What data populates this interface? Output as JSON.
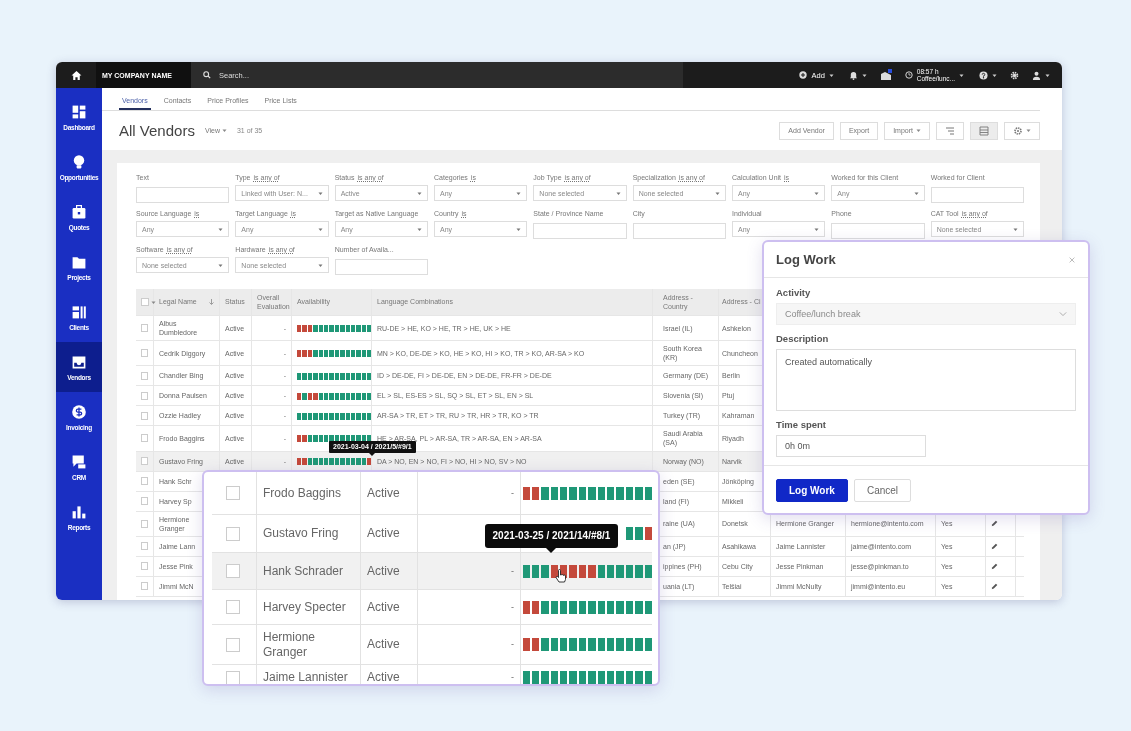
{
  "top_bar": {
    "company": "MY COMPANY NAME",
    "search": {
      "placeholder": "Search..."
    },
    "add": "Add",
    "timer": {
      "time": "08:57 h",
      "activity": "Coffee/lunc..."
    }
  },
  "sidebar": {
    "items": [
      {
        "label": "Dashboard",
        "kind": "dashboard",
        "selected": false
      },
      {
        "label": "Opportunities",
        "kind": "opportunities",
        "selected": false
      },
      {
        "label": "Quotes",
        "kind": "quotes",
        "selected": false
      },
      {
        "label": "Projects",
        "kind": "projects",
        "selected": false
      },
      {
        "label": "Clients",
        "kind": "clients",
        "selected": false
      },
      {
        "label": "Vendors",
        "kind": "vendors",
        "selected": true
      },
      {
        "label": "Invoicing",
        "kind": "invoicing",
        "selected": false
      },
      {
        "label": "CRM",
        "kind": "crm",
        "selected": false
      },
      {
        "label": "Reports",
        "kind": "reports",
        "selected": false
      }
    ]
  },
  "tabs": [
    {
      "label": "Vendors",
      "selected": true
    },
    {
      "label": "Contacts",
      "selected": false
    },
    {
      "label": "Price Profiles",
      "selected": false
    },
    {
      "label": "Price Lists",
      "selected": false
    }
  ],
  "page": {
    "title": "All Vendors",
    "view": "View",
    "count": "31 of 35"
  },
  "toolbar": [
    {
      "kind": "text",
      "label": "Add Vendor",
      "selected": false
    },
    {
      "kind": "text",
      "label": "Export",
      "selected": false
    },
    {
      "kind": "menu",
      "label": "Import",
      "selected": false
    },
    {
      "kind": "filter",
      "selected": false
    },
    {
      "kind": "grid",
      "selected": true
    },
    {
      "kind": "settings",
      "selected": false
    }
  ],
  "filters": [
    [
      {
        "label": "Text",
        "kind": "text"
      },
      {
        "label": "Type",
        "operator": "is any of",
        "kind": "select",
        "value": "Linked with User: N..."
      },
      {
        "label": "Status",
        "operator": "is any of",
        "kind": "select",
        "value": "Active"
      },
      {
        "label": "Categories",
        "operator": "is",
        "kind": "select",
        "value": "Any"
      },
      {
        "label": "Job Type",
        "operator": "is any of",
        "kind": "select",
        "value": "None selected"
      },
      {
        "label": "Specialization",
        "operator": "is any of",
        "kind": "select",
        "value": "None selected"
      },
      {
        "label": "Calculation Unit",
        "operator": "is",
        "kind": "select",
        "value": "Any"
      },
      {
        "label": "Worked for this Client",
        "kind": "select",
        "value": "Any"
      },
      {
        "label": "Worked for Client",
        "kind": "text"
      }
    ],
    [
      {
        "label": "Source Language",
        "operator": "is",
        "kind": "select",
        "value": "Any"
      },
      {
        "label": "Target Language",
        "operator": "is",
        "kind": "select",
        "value": "Any"
      },
      {
        "label": "Target as Native Language",
        "kind": "select",
        "value": "Any"
      },
      {
        "label": "Country",
        "operator": "is",
        "kind": "select",
        "value": "Any"
      },
      {
        "label": "State / Province Name",
        "kind": "text"
      },
      {
        "label": "City",
        "kind": "text"
      },
      {
        "label": "Individual",
        "kind": "select",
        "value": "Any"
      },
      {
        "label": "Phone",
        "kind": "text"
      },
      {
        "label": "CAT Tool",
        "operator": "is any of",
        "kind": "select",
        "value": "None selected"
      }
    ],
    [
      {
        "label": "Software",
        "operator": "is any of",
        "kind": "select",
        "value": "None selected"
      },
      {
        "label": "Hardware",
        "operator": "is any of",
        "kind": "select",
        "value": "None selected"
      },
      {
        "label": "Number of Availa...",
        "kind": "text"
      }
    ]
  ],
  "table": {
    "select_all": {
      "checked": false
    },
    "columns": [
      "Legal Name",
      "Status",
      "Overall Evaluation",
      "Availability",
      "Language Combinations",
      "Address - Country",
      "Address - Ci"
    ],
    "rows": [
      {
        "checked": false,
        "selected": false,
        "name": "Albus Dumbledore",
        "status": "Active",
        "evaluation": "-",
        "busy": [
          true,
          true,
          true,
          false,
          false,
          false,
          false,
          false,
          false,
          false,
          false,
          false,
          false,
          false
        ],
        "languages": "RU-DE > HE, KO > HE, TR > HE, UK > HE",
        "country": "Israel (IL)",
        "city": "Ashkelon"
      },
      {
        "checked": false,
        "selected": false,
        "name": "Cedrik Diggory",
        "status": "Active",
        "evaluation": "-",
        "busy": [
          true,
          true,
          true,
          false,
          false,
          false,
          false,
          false,
          false,
          false,
          false,
          false,
          false,
          false
        ],
        "languages": "MN > KO, DE-DE > KO, HE > KO, HI > KO, TR > KO, AR-SA > KO",
        "country": "South Korea (KR)",
        "city": "Chuncheon"
      },
      {
        "checked": false,
        "selected": false,
        "name": "Chandler Bing",
        "status": "Active",
        "evaluation": "-",
        "busy": [
          false,
          false,
          false,
          false,
          false,
          false,
          false,
          false,
          false,
          false,
          false,
          false,
          false,
          false
        ],
        "languages": "ID > DE-DE, FI > DE-DE, EN > DE-DE, FR-FR > DE-DE",
        "country": "Germany (DE)",
        "city": "Berlin"
      },
      {
        "checked": false,
        "selected": false,
        "name": "Donna Paulsen",
        "status": "Active",
        "evaluation": "-",
        "busy": [
          true,
          false,
          true,
          true,
          false,
          false,
          false,
          false,
          false,
          false,
          false,
          false,
          false,
          false
        ],
        "languages": "EL > SL, ES-ES > SL, SQ > SL, ET > SL, EN > SL",
        "country": "Slovenia (SI)",
        "city": "Ptuj"
      },
      {
        "checked": false,
        "selected": false,
        "name": "Ozzie Hadley",
        "status": "Active",
        "evaluation": "-",
        "busy": [
          false,
          false,
          false,
          false,
          false,
          false,
          false,
          false,
          false,
          false,
          false,
          false,
          false,
          false
        ],
        "languages": "AR-SA > TR, ET > TR, RU > TR, HR > TR, KO > TR",
        "country": "Turkey (TR)",
        "city": "Kahraman"
      },
      {
        "checked": false,
        "selected": false,
        "name": "Frodo Baggins",
        "status": "Active",
        "evaluation": "-",
        "busy": [
          true,
          true,
          false,
          false,
          false,
          false,
          false,
          false,
          false,
          false,
          false,
          false,
          false,
          false
        ],
        "languages": "HE > AR-SA, PL > AR-SA, TR > AR-SA, EN > AR-SA",
        "country": "Saudi Arabia (SA)",
        "city": "Riyadh"
      },
      {
        "checked": false,
        "selected": true,
        "name": "Gustavo Fring",
        "status": "Active",
        "evaluation": "-",
        "busy": [
          true,
          true,
          false,
          false,
          false,
          false,
          false,
          false,
          false,
          false,
          false,
          false,
          false,
          true
        ],
        "tooltip": "2021-03-04 / 2021/5/#9/1",
        "languages": "DA > NO, EN > NO, FI > NO, HI > NO, SV > NO",
        "country": "Norway (NO)",
        "city": "Narvik"
      },
      {
        "checked": false,
        "selected": false,
        "name": "Hank Schr",
        "country": "eden (SE)",
        "city": "Jönköping"
      },
      {
        "checked": false,
        "selected": false,
        "name": "Harvey Sp",
        "country": "land (FI)",
        "city": "Mikkeli"
      },
      {
        "checked": false,
        "selected": false,
        "name": "Hermione Granger",
        "country": "raine (UA)",
        "city": "Donetsk",
        "contact": "Hermione Granger",
        "email": "hermione@intento.com",
        "individual": "Yes",
        "editable": true
      },
      {
        "checked": false,
        "selected": false,
        "name": "Jaime Lann",
        "country": "an (JP)",
        "city": "Asahikawa",
        "contact": "Jaime Lannister",
        "email": "jaime@intento.com",
        "individual": "Yes",
        "editable": true
      },
      {
        "checked": false,
        "selected": false,
        "name": "Jesse Pink",
        "country": "ippines (PH)",
        "city": "Cebu City",
        "contact": "Jesse Pinkman",
        "email": "jesse@pinkman.to",
        "individual": "Yes",
        "editable": true
      },
      {
        "checked": false,
        "selected": false,
        "name": "Jimmi McN",
        "country": "uania (LT)",
        "city": "Telšiai",
        "contact": "Jimmi McNulty",
        "email": "jimmi@intento.eu",
        "individual": "Yes",
        "editable": true
      }
    ]
  },
  "zoom_callout": {
    "rows": [
      {
        "checked": false,
        "selected": false,
        "name": "Frodo Baggins",
        "status": "Active",
        "evaluation": "-",
        "busy": [
          true,
          true,
          false,
          false,
          false,
          false,
          false,
          false,
          false,
          false,
          false,
          false,
          false,
          false
        ]
      },
      {
        "checked": false,
        "selected": false,
        "name": "Gustavo Fring",
        "status": "Active",
        "busy": [
          false,
          false,
          true
        ]
      },
      {
        "checked": false,
        "selected": true,
        "name": "Hank Schrader",
        "status": "Active",
        "evaluation": "-",
        "busy": [
          false,
          false,
          false,
          true,
          true,
          true,
          true,
          true,
          false,
          false,
          false,
          false,
          false,
          false
        ],
        "tooltip": "2021-03-25 / 2021/14/#8/1"
      },
      {
        "checked": false,
        "selected": false,
        "name": "Harvey Specter",
        "status": "Active",
        "evaluation": "-",
        "busy": [
          true,
          true,
          false,
          false,
          false,
          false,
          false,
          false,
          false,
          false,
          false,
          false,
          false,
          false
        ]
      },
      {
        "checked": false,
        "selected": false,
        "name": "Hermione Granger",
        "status": "Active",
        "evaluation": "-",
        "busy": [
          true,
          true,
          false,
          false,
          false,
          false,
          false,
          false,
          false,
          false,
          false,
          false,
          false,
          false
        ]
      },
      {
        "checked": false,
        "selected": false,
        "name": "Jaime Lannister",
        "status": "Active",
        "evaluation": "-",
        "busy": [
          false,
          false,
          false,
          false,
          false,
          false,
          false,
          false,
          false,
          false,
          false,
          false,
          false,
          false
        ]
      }
    ]
  },
  "log_work_dialog": {
    "title": "Log Work",
    "activity": {
      "label": "Activity",
      "value": "Coffee/lunch break",
      "disabled": true
    },
    "description": {
      "label": "Description",
      "value": "Created automatically"
    },
    "time_spent": {
      "label": "Time spent",
      "value": "0h 0m"
    },
    "buttons": [
      {
        "label": "Log Work",
        "kind": "primary"
      },
      {
        "label": "Cancel",
        "kind": "secondary"
      }
    ]
  }
}
